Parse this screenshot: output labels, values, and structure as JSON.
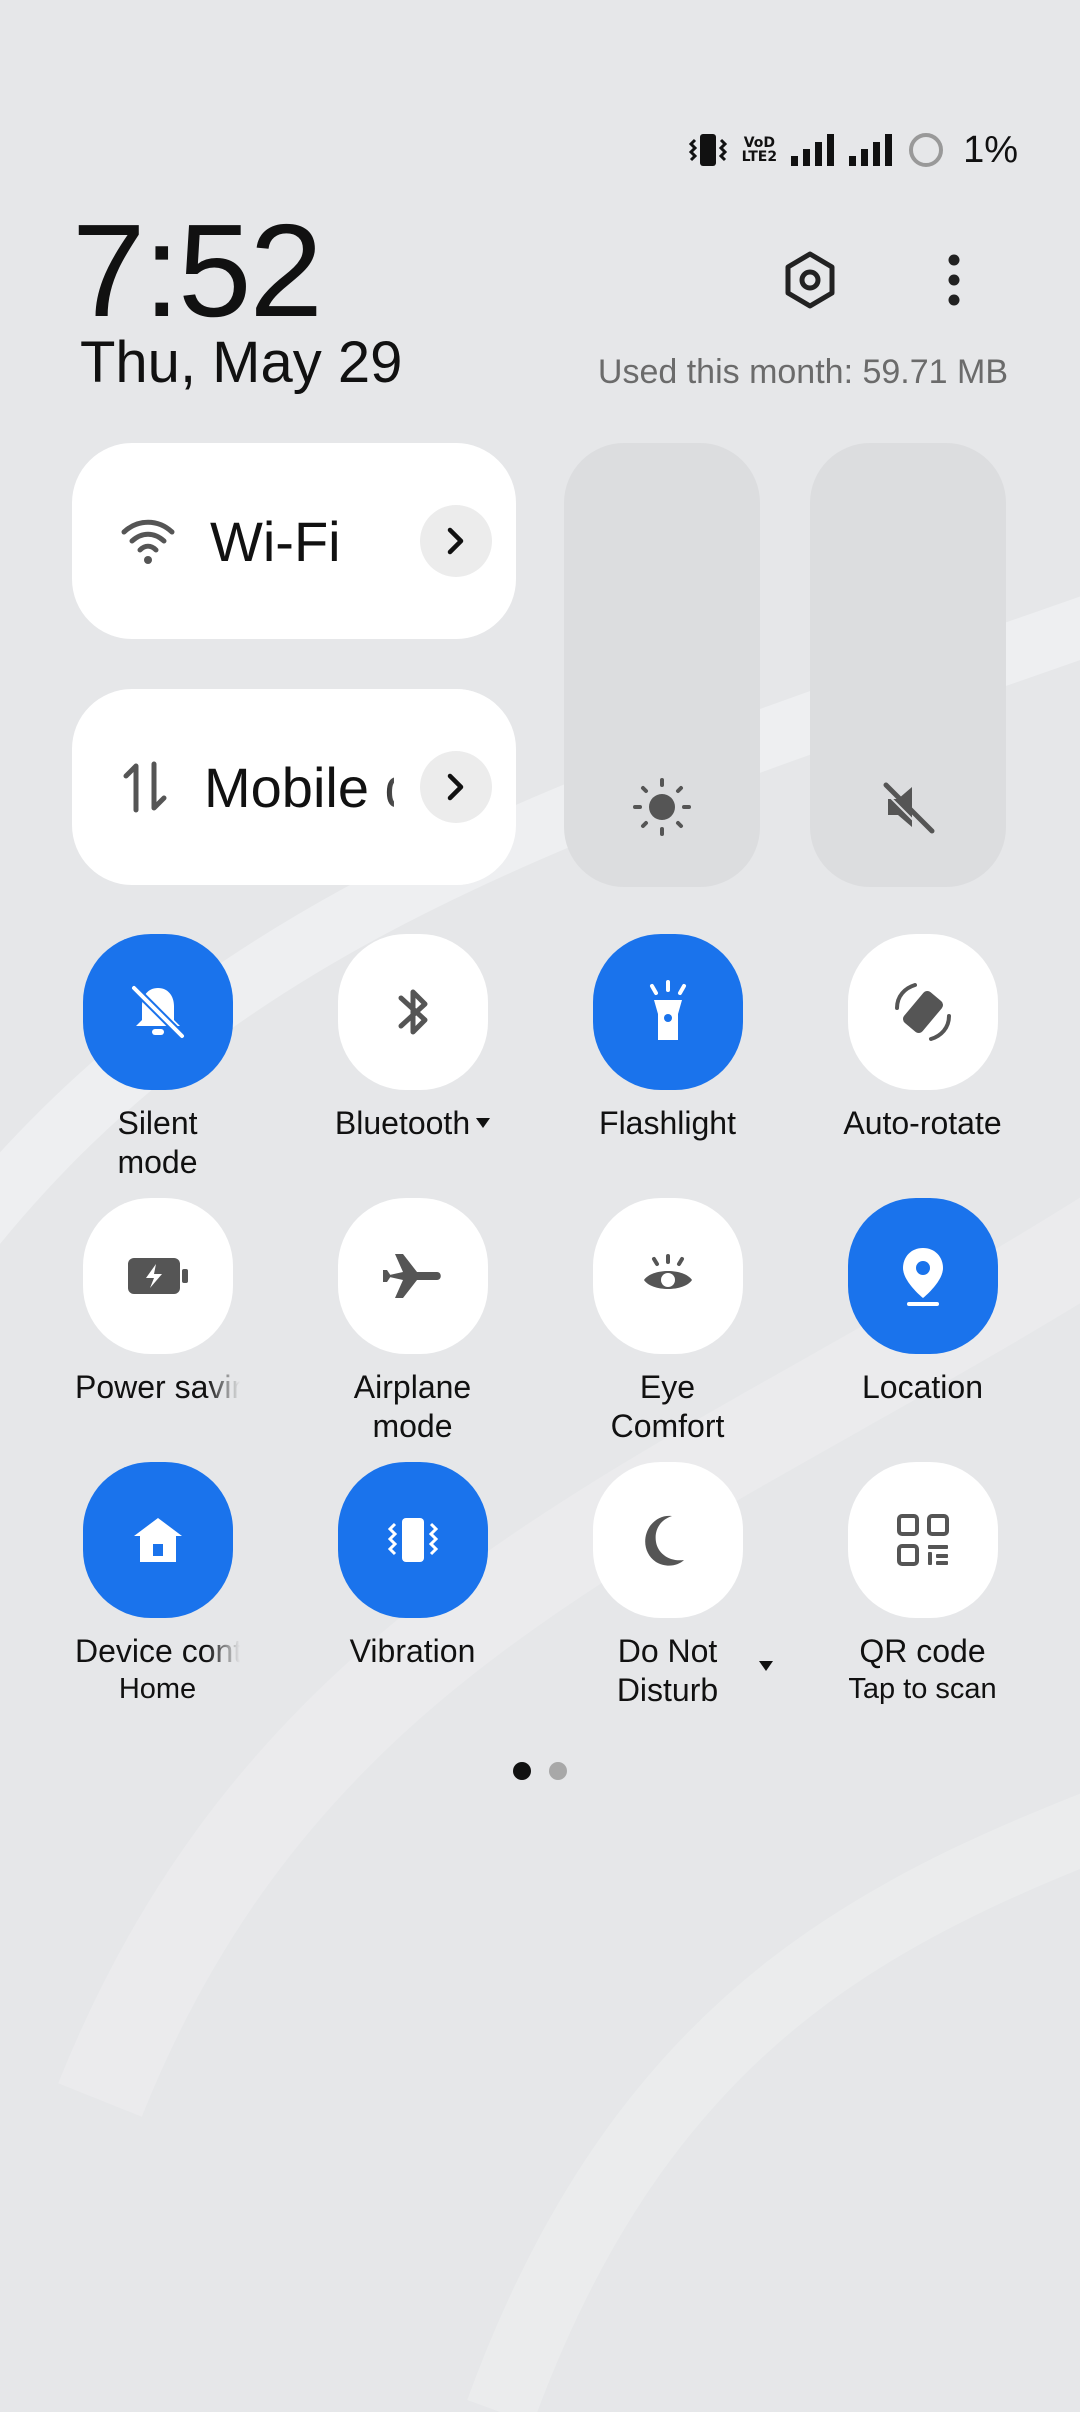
{
  "status_bar": {
    "volte_top": "VoD",
    "volte_bottom": "LTE2",
    "battery_percent": "1%",
    "icons": [
      "vibrate-icon",
      "volte-icon",
      "signal-icon",
      "signal-icon",
      "battery-icon"
    ]
  },
  "header": {
    "time": "7:52",
    "date": "Thu, May 29",
    "data_usage": "Used this month: 59.71 MB",
    "icons": [
      "settings-icon",
      "more-vert-icon"
    ]
  },
  "tiles": {
    "wifi_label": "Wi-Fi",
    "mobile_label": "Mobile data"
  },
  "sliders": {
    "brightness_icon": "brightness-icon",
    "volume_icon": "volume-mute-icon"
  },
  "toggles": [
    {
      "label": "Silent",
      "label2": "mode",
      "active": true,
      "icon": "bell-off-icon"
    },
    {
      "label": "Bluetooth",
      "active": false,
      "icon": "bluetooth-icon",
      "has_dropdown": true
    },
    {
      "label": "Flashlight",
      "active": true,
      "icon": "flashlight-icon"
    },
    {
      "label": "Auto-rotate",
      "active": false,
      "icon": "auto-rotate-icon"
    },
    {
      "label": "Power saving",
      "active": false,
      "icon": "battery-saver-icon"
    },
    {
      "label": "Airplane",
      "label2": "mode",
      "active": false,
      "icon": "airplane-icon"
    },
    {
      "label": "Eye",
      "label2": "Comfort",
      "active": false,
      "icon": "eye-icon"
    },
    {
      "label": "Location",
      "active": true,
      "icon": "location-pin-icon"
    },
    {
      "label": "Device controls",
      "sublabel": "Home",
      "active": true,
      "icon": "home-icon"
    },
    {
      "label": "Vibration",
      "active": true,
      "icon": "vibrate-icon"
    },
    {
      "label": "Do Not",
      "label2": "Disturb",
      "active": false,
      "icon": "moon-icon",
      "has_dropdown": true
    },
    {
      "label": "QR code",
      "sublabel": "Tap to scan",
      "active": false,
      "icon": "qr-code-icon"
    }
  ],
  "pagination": {
    "current_page": 1,
    "total_pages": 2
  },
  "colors": {
    "accent": "#1A73EC",
    "background": "#E6E7E9",
    "tile": "#FFFFFF",
    "slider": "#DCDDDF"
  }
}
